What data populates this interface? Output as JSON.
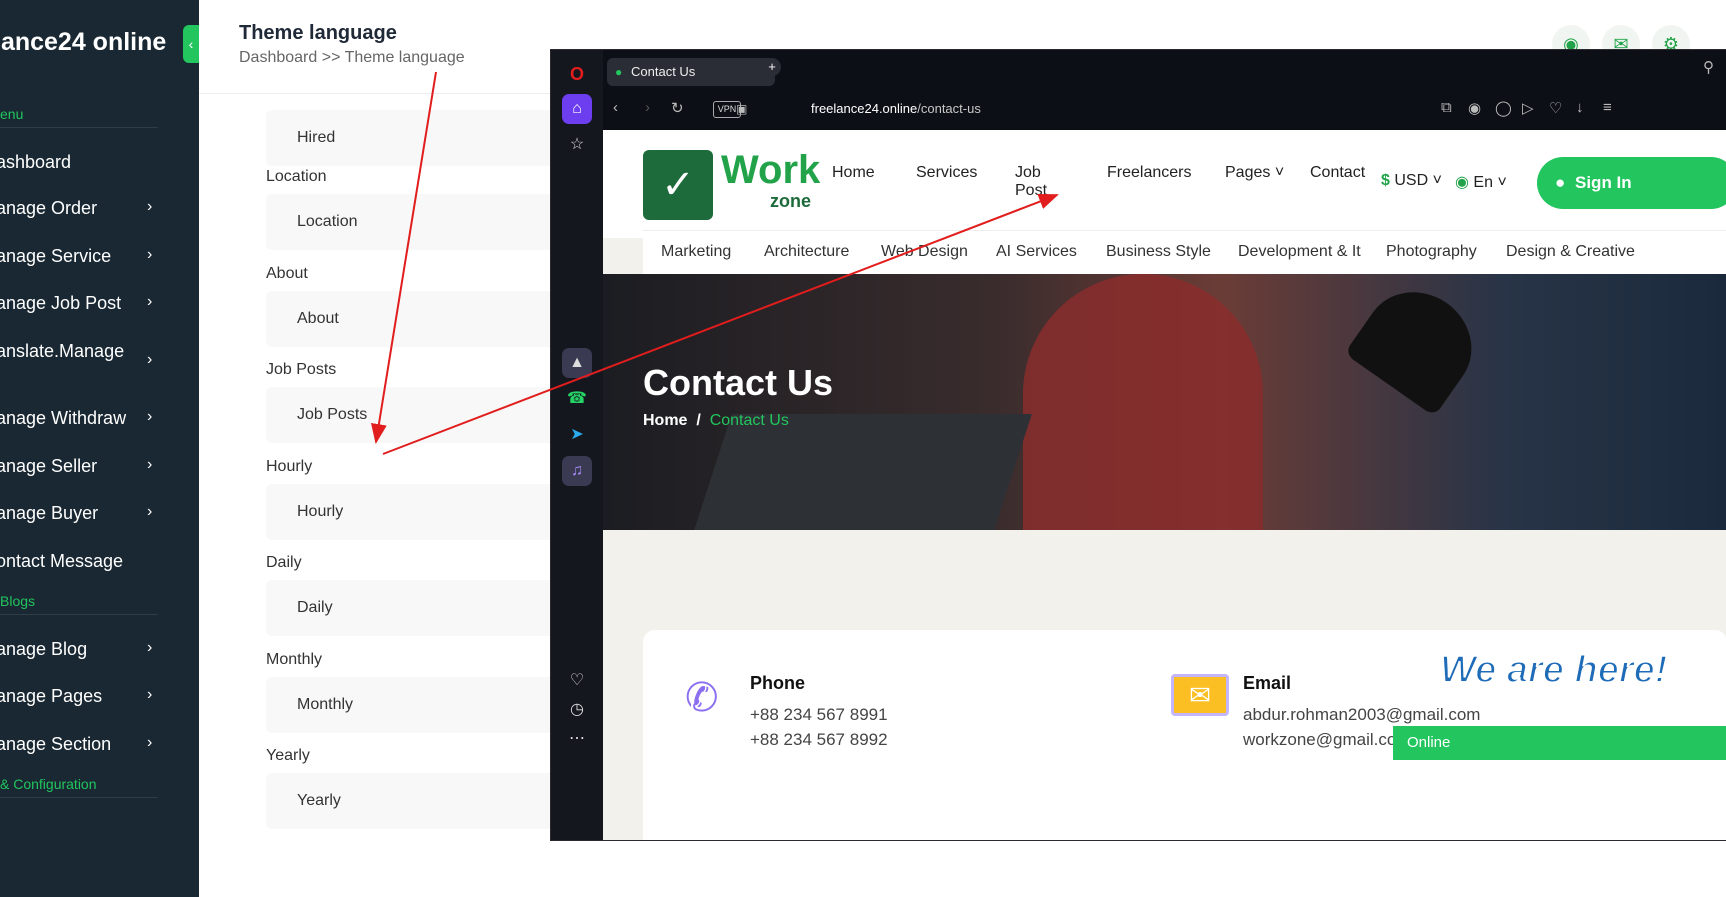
{
  "sidebar": {
    "brand": "lance24 online",
    "toggle_glyph": "‹",
    "section_menu": "enu",
    "section_blogs": "Blogs",
    "section_config": "& Configuration",
    "items": [
      {
        "label": "ashboard"
      },
      {
        "label": "anage Order",
        "chevron": "›"
      },
      {
        "label": "anage Service",
        "chevron": "›"
      },
      {
        "label": "anage Job Post",
        "chevron": "›"
      },
      {
        "label": "anslate.Manage",
        "chevron": "›"
      },
      {
        "label": "anage Withdraw",
        "chevron": "›"
      },
      {
        "label": "anage Seller",
        "chevron": "›"
      },
      {
        "label": "anage Buyer",
        "chevron": "›"
      },
      {
        "label": "ontact Message"
      },
      {
        "label": "anage Blog",
        "chevron": "›"
      },
      {
        "label": "anage Pages",
        "chevron": "›"
      },
      {
        "label": "anage Section",
        "chevron": "›"
      }
    ]
  },
  "header": {
    "title": "Theme language",
    "breadcrumb": "Dashboard >> Theme language",
    "icons": [
      "globe-icon",
      "chat-icon",
      "settings-icon"
    ]
  },
  "form": {
    "fields": [
      {
        "label": "",
        "value": "Hired"
      },
      {
        "label": "Location",
        "value": "Location"
      },
      {
        "label": "About",
        "value": "About"
      },
      {
        "label": "Job Posts",
        "value": "Job Posts"
      },
      {
        "label": "Hourly",
        "value": "Hourly"
      },
      {
        "label": "Daily",
        "value": "Daily"
      },
      {
        "label": "Monthly",
        "value": "Monthly"
      },
      {
        "label": "Yearly",
        "value": "Yearly"
      }
    ]
  },
  "browser": {
    "tab_title": "Contact Us",
    "new_tab": "+",
    "vpn": "VPN",
    "url_host": "freelance24.online",
    "url_path": "/contact-us"
  },
  "site": {
    "logo_work": "Work",
    "logo_zone": "zone",
    "nav": [
      "Home",
      "Services",
      "Job",
      "Post",
      "Freelancers",
      "Pages",
      "Contact"
    ],
    "currency": "USD",
    "currency_symbol": "$",
    "language": "En",
    "signin": "Sign In",
    "categories": [
      "Marketing",
      "Architecture",
      "Web Design",
      "AI Services",
      "Business Style",
      "Development & It",
      "Photography",
      "Design & Creative"
    ],
    "hero_title": "Contact Us",
    "hero_home": "Home",
    "hero_sep": "/",
    "hero_current": "Contact Us",
    "phone_title": "Phone",
    "phone_1": "+88 234 567 8991",
    "phone_2": "+88 234 567 8992",
    "email_title": "Email",
    "email_1": "abdur.rohman2003@gmail.com",
    "email_2": "workzone@gmail.com",
    "we_are_here": "We are here!",
    "online": "Online"
  },
  "colors": {
    "accent": "#22c55e",
    "sidebar_bg": "#192832",
    "arrow": "#e11d1d"
  }
}
